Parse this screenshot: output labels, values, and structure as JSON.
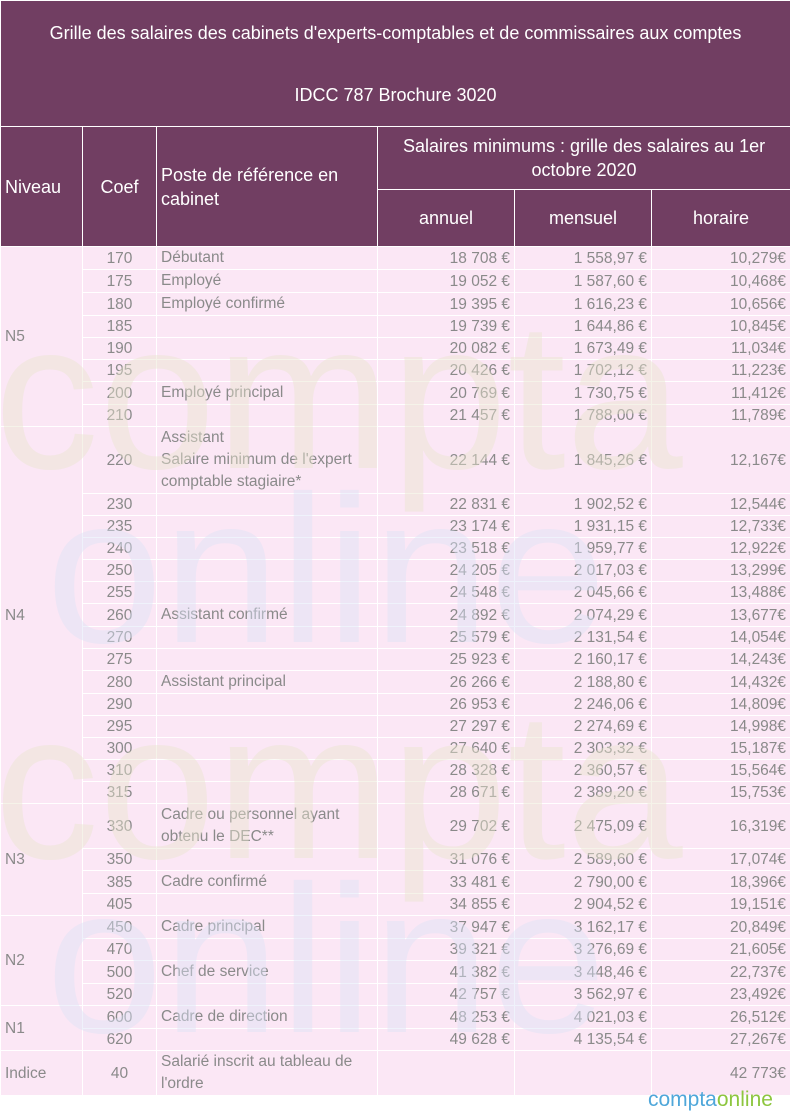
{
  "title_line1": "Grille des salaires des cabinets d'experts-comptables et de commissaires aux comptes",
  "title_line2": "IDCC 787 Brochure 3020",
  "headers": {
    "niveau": "Niveau",
    "coef": "Coef",
    "poste": "Poste de référence en cabinet",
    "salaires": "Salaires minimums : grille des salaires au 1er octobre 2020",
    "annuel": "annuel",
    "mensuel": "mensuel",
    "horaire": "horaire"
  },
  "rows": [
    {
      "niveau": "N5",
      "coef": "170",
      "poste": "Débutant",
      "annuel": "18 708 €",
      "mensuel": "1 558,97 €",
      "horaire": "10,279€"
    },
    {
      "niveau": "N5",
      "coef": "175",
      "poste": "Employé",
      "annuel": "19 052 €",
      "mensuel": "1 587,60 €",
      "horaire": "10,468€"
    },
    {
      "niveau": "N5",
      "coef": "180",
      "poste": "Employé confirmé",
      "annuel": "19 395 €",
      "mensuel": "1 616,23 €",
      "horaire": "10,656€"
    },
    {
      "niveau": "N5",
      "coef": "185",
      "poste": "",
      "annuel": "19 739 €",
      "mensuel": "1 644,86 €",
      "horaire": "10,845€"
    },
    {
      "niveau": "N5",
      "coef": "190",
      "poste": "",
      "annuel": "20 082 €",
      "mensuel": "1 673,49 €",
      "horaire": "11,034€"
    },
    {
      "niveau": "N5",
      "coef": "195",
      "poste": "",
      "annuel": "20 426 €",
      "mensuel": "1 702,12 €",
      "horaire": "11,223€"
    },
    {
      "niveau": "N5",
      "coef": "200",
      "poste": "Employé principal",
      "annuel": "20 769 €",
      "mensuel": "1 730,75 €",
      "horaire": "11,412€"
    },
    {
      "niveau": "N5",
      "coef": "210",
      "poste": "",
      "annuel": "21 457 €",
      "mensuel": "1 788,00 €",
      "horaire": "11,789€"
    },
    {
      "niveau": "N4",
      "coef": "220",
      "poste": "Assistant\nSalaire minimum de l'expert comptable stagiaire*",
      "annuel": "22 144 €",
      "mensuel": "1 845,26 €",
      "horaire": "12,167€"
    },
    {
      "niveau": "N4",
      "coef": "230",
      "poste": "",
      "annuel": "22 831 €",
      "mensuel": "1 902,52 €",
      "horaire": "12,544€"
    },
    {
      "niveau": "N4",
      "coef": "235",
      "poste": "",
      "annuel": "23 174 €",
      "mensuel": "1 931,15 €",
      "horaire": "12,733€"
    },
    {
      "niveau": "N4",
      "coef": "240",
      "poste": "",
      "annuel": "23 518 €",
      "mensuel": "1 959,77 €",
      "horaire": "12,922€"
    },
    {
      "niveau": "N4",
      "coef": "250",
      "poste": "",
      "annuel": "24 205 €",
      "mensuel": "2 017,03 €",
      "horaire": "13,299€"
    },
    {
      "niveau": "N4",
      "coef": "255",
      "poste": "",
      "annuel": "24 548 €",
      "mensuel": "2 045,66 €",
      "horaire": "13,488€"
    },
    {
      "niveau": "N4",
      "coef": "260",
      "poste": "Assistant confirmé",
      "annuel": "24 892 €",
      "mensuel": "2 074,29 €",
      "horaire": "13,677€"
    },
    {
      "niveau": "N4",
      "coef": "270",
      "poste": "",
      "annuel": "25 579 €",
      "mensuel": "2 131,54 €",
      "horaire": "14,054€"
    },
    {
      "niveau": "N4",
      "coef": "275",
      "poste": "",
      "annuel": "25 923 €",
      "mensuel": "2 160,17 €",
      "horaire": "14,243€"
    },
    {
      "niveau": "N4",
      "coef": "280",
      "poste": "Assistant principal",
      "annuel": "26 266 €",
      "mensuel": "2 188,80 €",
      "horaire": "14,432€"
    },
    {
      "niveau": "N4",
      "coef": "290",
      "poste": "",
      "annuel": "26 953 €",
      "mensuel": "2 246,06 €",
      "horaire": "14,809€"
    },
    {
      "niveau": "N4",
      "coef": "295",
      "poste": "",
      "annuel": "27 297 €",
      "mensuel": "2 274,69 €",
      "horaire": "14,998€"
    },
    {
      "niveau": "N4",
      "coef": "300",
      "poste": "",
      "annuel": "27 640 €",
      "mensuel": "2 303,32 €",
      "horaire": "15,187€"
    },
    {
      "niveau": "N4",
      "coef": "310",
      "poste": "",
      "annuel": "28 328 €",
      "mensuel": "2 360,57 €",
      "horaire": "15,564€"
    },
    {
      "niveau": "N4",
      "coef": "315",
      "poste": "",
      "annuel": "28 671 €",
      "mensuel": "2 389,20 €",
      "horaire": "15,753€"
    },
    {
      "niveau": "N3",
      "coef": "330",
      "poste": "Cadre ou personnel ayant obtenu le DEC**",
      "annuel": "29 702 €",
      "mensuel": "2 475,09 €",
      "horaire": "16,319€"
    },
    {
      "niveau": "N3",
      "coef": "350",
      "poste": "",
      "annuel": "31 076 €",
      "mensuel": "2 589,60 €",
      "horaire": "17,074€"
    },
    {
      "niveau": "N3",
      "coef": "385",
      "poste": "Cadre confirmé",
      "annuel": "33 481 €",
      "mensuel": "2 790,00 €",
      "horaire": "18,396€"
    },
    {
      "niveau": "N3",
      "coef": "405",
      "poste": "",
      "annuel": "34 855 €",
      "mensuel": "2 904,52 €",
      "horaire": "19,151€"
    },
    {
      "niveau": "N2",
      "coef": "450",
      "poste": "Cadre principal",
      "annuel": "37 947 €",
      "mensuel": "3 162,17 €",
      "horaire": "20,849€"
    },
    {
      "niveau": "N2",
      "coef": "470",
      "poste": "",
      "annuel": "39 321 €",
      "mensuel": "3 276,69 €",
      "horaire": "21,605€"
    },
    {
      "niveau": "N2",
      "coef": "500",
      "poste": "Chef de service",
      "annuel": "41 382 €",
      "mensuel": "3 448,46 €",
      "horaire": "22,737€"
    },
    {
      "niveau": "N2",
      "coef": "520",
      "poste": "",
      "annuel": "42 757 €",
      "mensuel": "3 562,97 €",
      "horaire": "23,492€"
    },
    {
      "niveau": "N1",
      "coef": "600",
      "poste": "Cadre de direction",
      "annuel": "48 253 €",
      "mensuel": "4 021,03 €",
      "horaire": "26,512€"
    },
    {
      "niveau": "N1",
      "coef": "620",
      "poste": "",
      "annuel": "49 628 €",
      "mensuel": "4 135,54 €",
      "horaire": "27,267€"
    },
    {
      "niveau": "Indice",
      "coef": "40",
      "poste": "Salarié inscrit au tableau de l'ordre",
      "annuel": "",
      "mensuel": "",
      "horaire": "42 773€"
    }
  ],
  "watermark": {
    "word1": "compta",
    "word2": "online",
    "color1": "#e9e4cf",
    "color2": "#dbe2f6"
  },
  "logo": {
    "part1": "compta",
    "part2": "online",
    "color1": "#4fa7da",
    "color2": "#8dc63f"
  }
}
